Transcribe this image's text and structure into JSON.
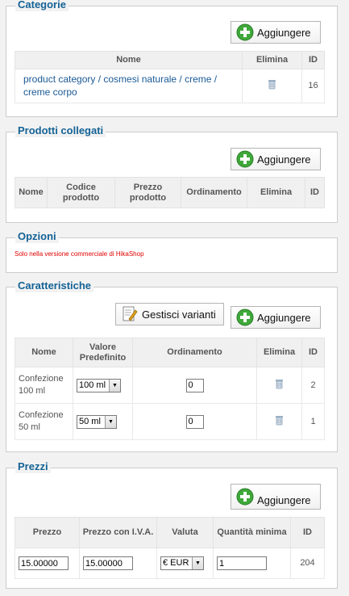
{
  "categorie": {
    "legend": "Categorie",
    "add_label": "Aggiungere",
    "headers": [
      "Nome",
      "Elimina",
      "ID"
    ],
    "row": {
      "name": "product category / cosmesi naturale / creme / creme corpo",
      "id": "16"
    }
  },
  "prodotti": {
    "legend": "Prodotti collegati",
    "add_label": "Aggiungere",
    "headers": [
      "Nome",
      "Codice prodotto",
      "Prezzo prodotto",
      "Ordinamento",
      "Elimina",
      "ID"
    ]
  },
  "opzioni": {
    "legend": "Opzioni",
    "note": "Solo nella versione commerciale di HikaShop"
  },
  "caratteristiche": {
    "legend": "Caratteristiche",
    "manage_label": "Gestisci varianti",
    "add_label": "Aggiungere",
    "headers": [
      "Nome",
      "Valore Predefinito",
      "Ordinamento",
      "Elimina",
      "ID"
    ],
    "rows": [
      {
        "name": "Confezione 100 ml",
        "value": "100 ml",
        "order": "0",
        "id": "2"
      },
      {
        "name": "Confezione 50 ml",
        "value": "50 ml",
        "order": "0",
        "id": "1"
      }
    ]
  },
  "prezzi": {
    "legend": "Prezzi",
    "add_label": "Aggiungere",
    "headers": [
      "Prezzo",
      "Prezzo con I.V.A.",
      "Valuta",
      "Quantità minima",
      "ID"
    ],
    "row": {
      "price": "15.00000",
      "price_vat": "15.00000",
      "currency": "€ EUR",
      "min_qty": "1",
      "id": "204"
    }
  },
  "icons": {
    "add": "green-plus-icon",
    "trash": "trash-icon",
    "manage": "edit-document-icon",
    "dropdown": "dropdown-arrow-icon"
  }
}
